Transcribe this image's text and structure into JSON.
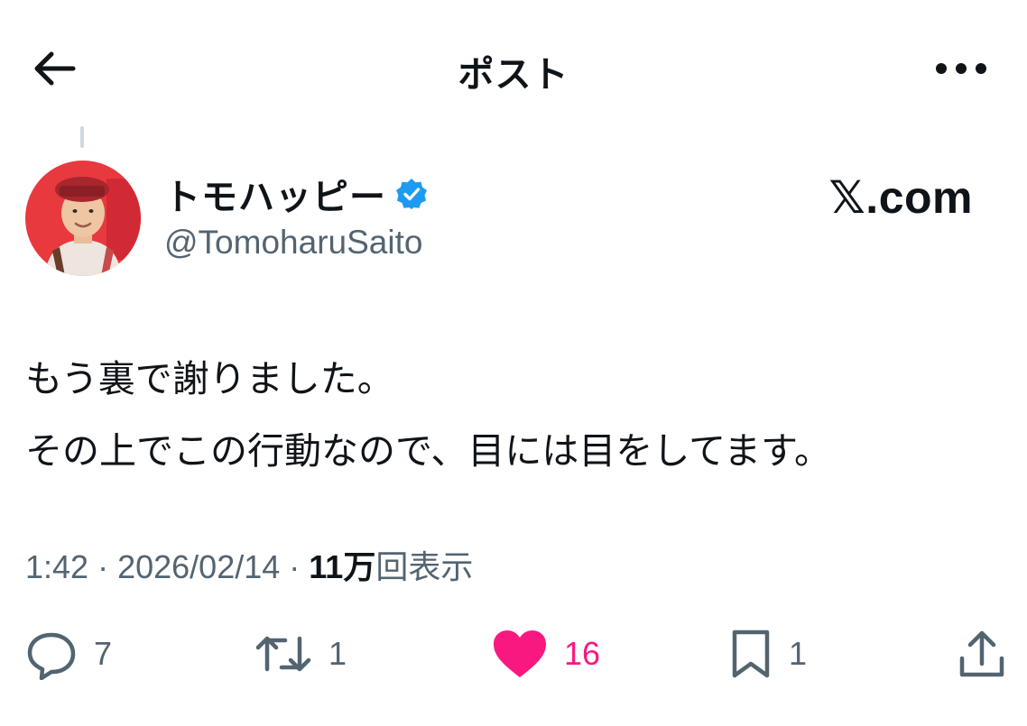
{
  "header": {
    "title": "ポスト",
    "back_icon": "arrow-left-icon",
    "more_icon": "more-horizontal-icon"
  },
  "author": {
    "display_name": "トモハッピー",
    "handle": "@TomoharuSaito",
    "verified_color": "#1d9bf0"
  },
  "watermark": "𝕏.com",
  "post": {
    "lines": [
      "もう裏で謝りました。",
      "その上でこの行動なので、目には目をしてます。"
    ]
  },
  "meta": {
    "time": "1:42",
    "sep1": " · ",
    "date": "2026/02/14",
    "sep2": " · ",
    "views_count": "11万",
    "views_label": "回表示"
  },
  "actions": {
    "reply": {
      "icon": "reply-icon",
      "count": "7"
    },
    "repost": {
      "icon": "repost-icon",
      "count": "1"
    },
    "like": {
      "icon": "heart-icon",
      "count": "16",
      "color": "#f91880"
    },
    "bookmark": {
      "icon": "bookmark-icon",
      "count": "1"
    },
    "share": {
      "icon": "share-icon"
    }
  }
}
